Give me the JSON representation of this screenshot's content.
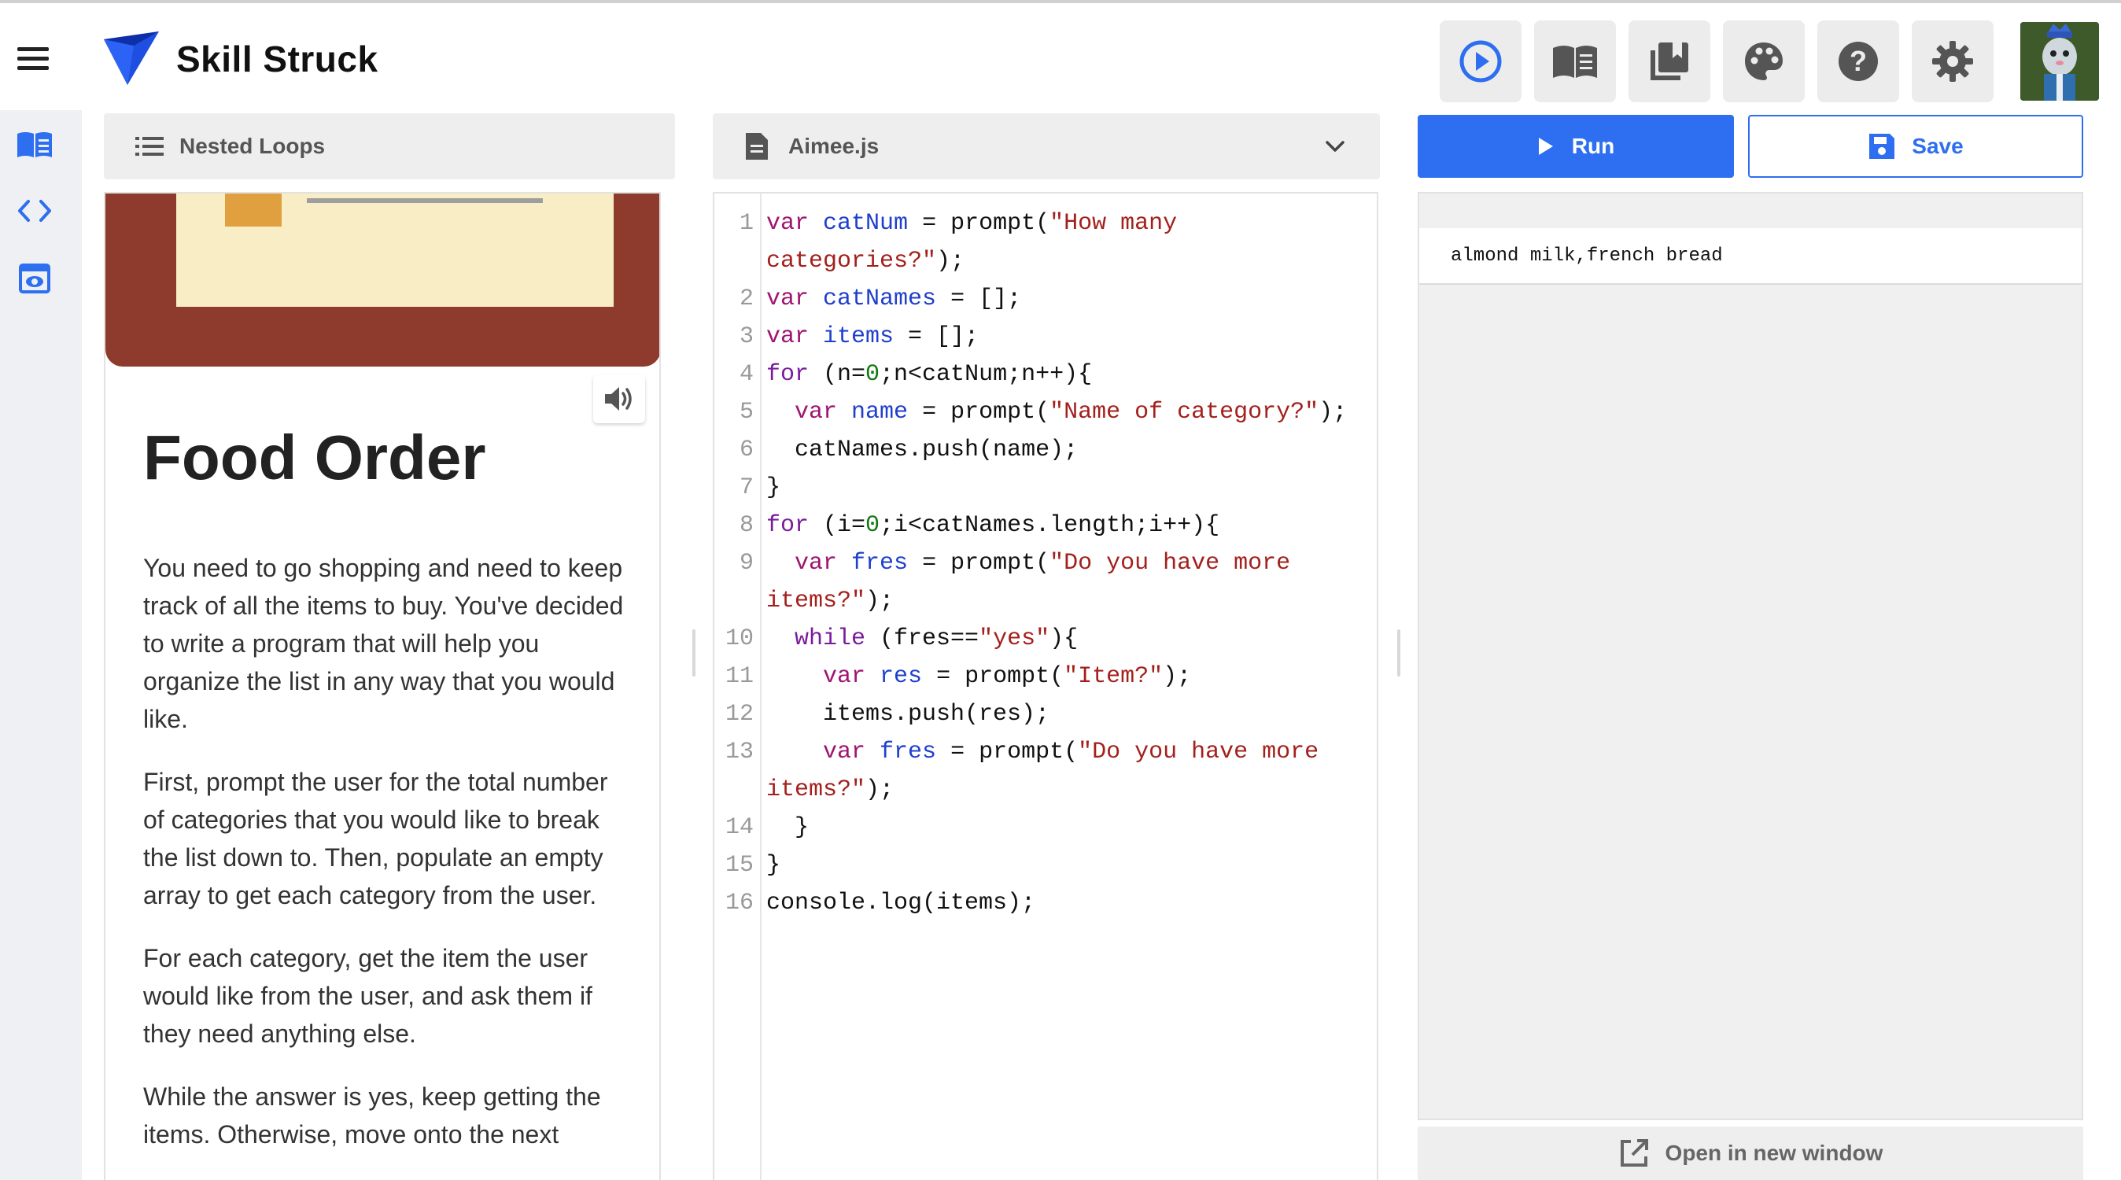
{
  "app": {
    "brand": "Skill Struck"
  },
  "header_buttons": [
    {
      "name": "play-circle-icon"
    },
    {
      "name": "book-open-icon"
    },
    {
      "name": "library-icon"
    },
    {
      "name": "palette-icon"
    },
    {
      "name": "help-icon"
    },
    {
      "name": "gear-icon"
    }
  ],
  "sidebar": {
    "items": [
      {
        "name": "book-icon"
      },
      {
        "name": "code-icon"
      },
      {
        "name": "preview-icon"
      }
    ]
  },
  "lesson": {
    "header": "Nested Loops",
    "title": "Food Order",
    "paragraphs": [
      "You need to go shopping and need to keep track of all the items to buy. You've decided to write a program that will help you organize the list in any way that you would like.",
      "First, prompt the user for the total number of categories that you would like to break the list down to. Then, populate an empty array to get each category from the user.",
      "For each category, get the item the user would like from the user, and ask them if they need anything else.",
      "While the answer is yes, keep getting the items. Otherwise, move onto the next"
    ]
  },
  "editor": {
    "file_name": "Aimee.js",
    "lines": [
      "1",
      "2",
      "3",
      "4",
      "5",
      "6",
      "7",
      "8",
      "9",
      "10",
      "11",
      "12",
      "13",
      "14",
      "15",
      "16"
    ],
    "code": {
      "l1a": "var",
      "l1b": "catNum",
      "l1c": " = prompt(",
      "l1d": "\"How many categories?\"",
      "l1e": ");",
      "l2a": "var",
      "l2b": "catNames",
      "l2c": " = [];",
      "l3a": "var",
      "l3b": "items",
      "l3c": " = [];",
      "l4a": "for",
      "l4b": " (n=",
      "l4c": "0",
      "l4d": ";n<catNum;n++){",
      "l5a": "  var",
      "l5b": "name",
      "l5c": " = prompt(",
      "l5d": "\"Name of category?\"",
      "l5e": ");",
      "l6": "  catNames.push(name);",
      "l7": "}",
      "l8a": "for",
      "l8b": " (i=",
      "l8c": "0",
      "l8d": ";i<catNames.length;i++){",
      "l9a": "  var",
      "l9b": "fres",
      "l9c": " = prompt(",
      "l9d": "\"Do you have more items?\"",
      "l9e": ");",
      "l10a": "  while",
      "l10b": " (fres==",
      "l10c": "\"yes\"",
      "l10d": "){",
      "l11a": "    var",
      "l11b": "res",
      "l11c": " = prompt(",
      "l11d": "\"Item?\"",
      "l11e": ");",
      "l12": "    items.push(res);",
      "l13a": "    var",
      "l13b": "fres",
      "l13c": " = prompt(",
      "l13d": "\"Do you have more items?\"",
      "l13e": ");",
      "l14": "  }",
      "l15": "}",
      "l16": "console.log(items);"
    }
  },
  "actions": {
    "run_label": "Run",
    "save_label": "Save"
  },
  "output": {
    "line": "almond milk,french bread",
    "open_window_label": "Open in new window"
  },
  "colors": {
    "accent": "#2e6ef0",
    "lesson_image": "#8e3a2c"
  }
}
